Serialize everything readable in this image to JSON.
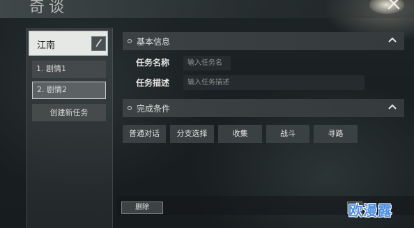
{
  "window": {
    "title": "奇谈",
    "close_icon": "close-icon"
  },
  "sidebar": {
    "region": {
      "name": "江南",
      "edit_icon": "brush-icon"
    },
    "items": [
      {
        "label": "1. 剧情1",
        "selected": false
      },
      {
        "label": "2. 剧情2",
        "selected": true
      }
    ],
    "new_task_label": "创建新任务"
  },
  "basic_info": {
    "header": "基本信息",
    "name_label": "任务名称",
    "name_placeholder": "输入任务名",
    "desc_label": "任务描述",
    "desc_placeholder": "输入任务描述"
  },
  "conditions": {
    "header": "完成条件",
    "options": [
      "普通对话",
      "分支选择",
      "收集",
      "战斗",
      "寻路"
    ]
  },
  "footer": {
    "delete_label": "删除",
    "next_label": ">"
  },
  "watermark": "欧漫露",
  "colors": {
    "background": "#1a2022",
    "panel": "#3e4446",
    "selected_card": "#e6e8e6",
    "watermark": "#4d8fe0"
  }
}
